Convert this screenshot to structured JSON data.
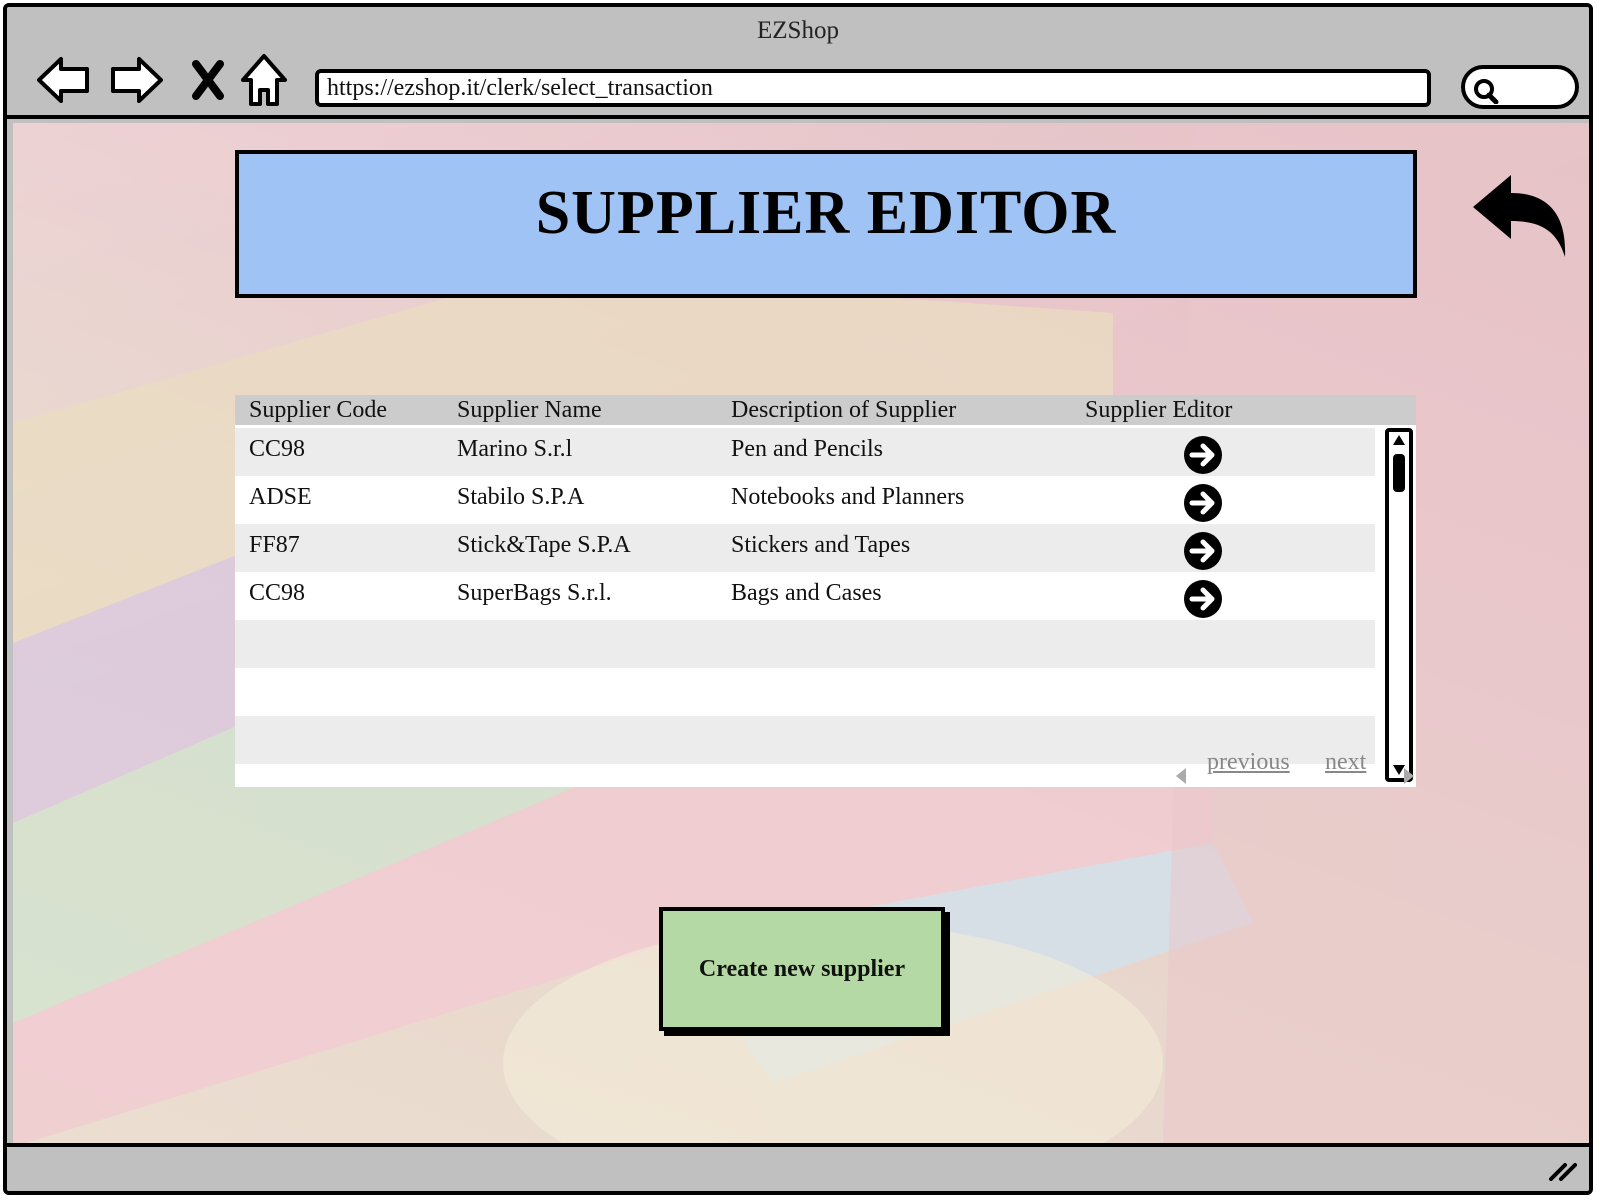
{
  "window": {
    "title": "EZShop",
    "url": "https://ezshop.it/clerk/select_transaction"
  },
  "nav": {
    "back_icon": "arrow-left-icon",
    "forward_icon": "arrow-right-icon",
    "close_icon": "x-icon",
    "home_icon": "home-icon",
    "search_icon": "search-icon"
  },
  "page": {
    "title": "SUPPLIER EDITOR",
    "return_icon": "return-arrow-icon"
  },
  "table": {
    "headers": [
      "Supplier Code",
      "Supplier Name",
      "Description of Supplier",
      "Supplier Editor"
    ],
    "rows": [
      {
        "code": "CC98",
        "name": "Marino S.r.l",
        "description": "Pen and Pencils"
      },
      {
        "code": "ADSE",
        "name": "Stabilo S.P.A",
        "description": "Notebooks and Planners"
      },
      {
        "code": "FF87",
        "name": "Stick&Tape S.P.A",
        "description": "Stickers and Tapes"
      },
      {
        "code": "CC98",
        "name": "SuperBags S.r.l.",
        "description": "Bags and Cases"
      }
    ],
    "pager": {
      "previous": "previous",
      "next": "next"
    }
  },
  "actions": {
    "create_label": "Create new supplier"
  },
  "colors": {
    "banner": "#a0c3f5",
    "create_button": "#b5d9a4",
    "header_row": "#cccccc",
    "chrome": "#c0c0c0"
  }
}
